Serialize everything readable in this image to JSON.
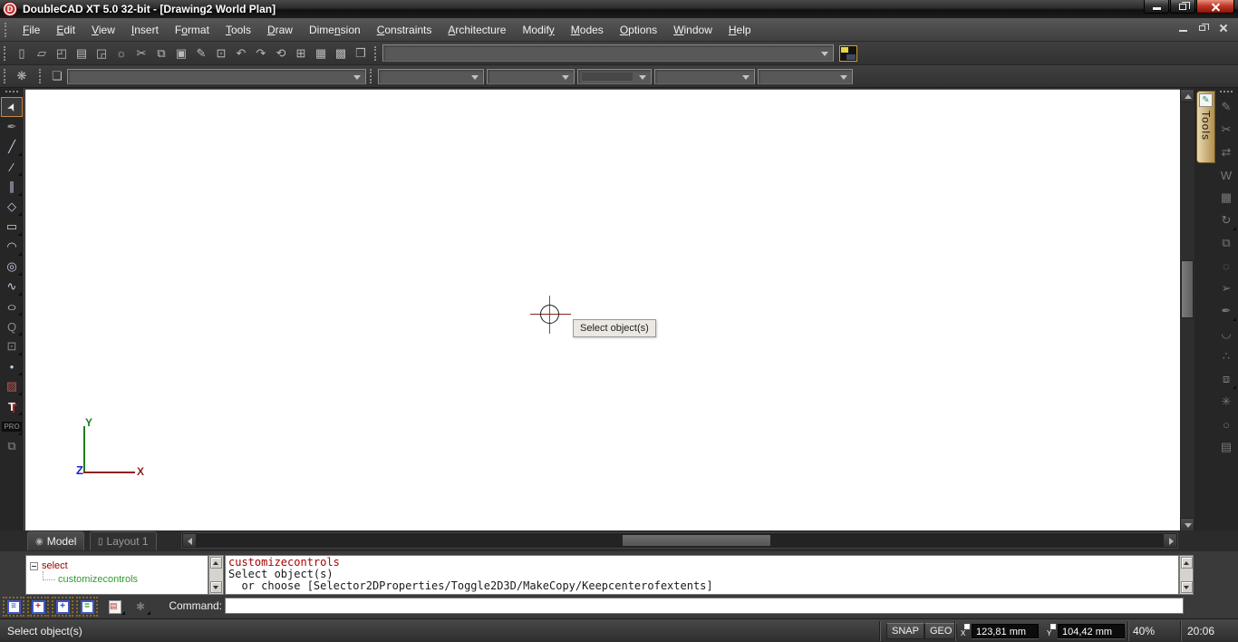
{
  "window": {
    "logo_letter": "D",
    "title": "DoubleCAD XT 5.0 32-bit - [Drawing2 World Plan]"
  },
  "menu": {
    "items": [
      {
        "pre": "",
        "key": "F",
        "post": "ile"
      },
      {
        "pre": "",
        "key": "E",
        "post": "dit"
      },
      {
        "pre": "",
        "key": "V",
        "post": "iew"
      },
      {
        "pre": "",
        "key": "I",
        "post": "nsert"
      },
      {
        "pre": "F",
        "key": "o",
        "post": "rmat"
      },
      {
        "pre": "",
        "key": "T",
        "post": "ools"
      },
      {
        "pre": "",
        "key": "D",
        "post": "raw"
      },
      {
        "pre": "Dime",
        "key": "n",
        "post": "sion"
      },
      {
        "pre": "",
        "key": "C",
        "post": "onstraints"
      },
      {
        "pre": "",
        "key": "A",
        "post": "rchitecture"
      },
      {
        "pre": "Modif",
        "key": "y",
        "post": ""
      },
      {
        "pre": "",
        "key": "M",
        "post": "odes"
      },
      {
        "pre": "",
        "key": "O",
        "post": "ptions"
      },
      {
        "pre": "",
        "key": "W",
        "post": "indow"
      },
      {
        "pre": "",
        "key": "H",
        "post": "elp"
      }
    ]
  },
  "icons": {
    "new": "▯",
    "open": "▱",
    "save": "◰",
    "print": "▤",
    "print_preview": "◲",
    "settings": "☼",
    "cut": "✂",
    "copy": "⧉",
    "paste": "▣",
    "format_brush": "✎",
    "zoom_box": "⊡",
    "undo": "↶",
    "redo": "↷",
    "rotate": "⟲",
    "zoom_extents": "⊞",
    "table": "▦",
    "calculator": "▩",
    "help_book": "❒",
    "selection_filter": "❋",
    "layers": "❏",
    "select": "➤",
    "pen": "✒",
    "line": "╱",
    "polyline": "∕",
    "double_line": "∥",
    "polygon": "◇",
    "rectangle": "▭",
    "arc": "◠",
    "circle": "◎",
    "spline": "∿",
    "ellipse": "○",
    "text_annotation": "Q",
    "group": "⊡",
    "point": "•",
    "image": "▨",
    "text": "T",
    "pro": "PRO",
    "paste_special": "⧉",
    "rt_sketch": "✎",
    "rt_trim": "✂",
    "rt_mirror": "⇄",
    "rt_wall": "W",
    "rt_hatch": "▦",
    "rt_rotate": "↻",
    "rt_array": "⧉",
    "rt_region": "◌",
    "rt_pull": "➢",
    "rt_pen": "✒",
    "rt_arc": "◡",
    "rt_node": "∴",
    "rt_blocks": "⧈",
    "rt_explode": "✳",
    "rt_circle": "○",
    "rt_plot": "▤",
    "model_tab": "◉",
    "layout_tab": "▯",
    "tools_tab_pen": "✎",
    "console_lines": "≡",
    "console_error": "+",
    "console_info": "+",
    "console_ok": "=",
    "console_doc": "▤",
    "console_pin": "✱"
  },
  "canvas": {
    "tooltip": "Select object(s)",
    "ucs": {
      "x": "X",
      "y": "Y",
      "z": "Z"
    }
  },
  "sheet_tabs": {
    "model": "Model",
    "layout": "Layout 1"
  },
  "tools_palette": {
    "label": "Tools"
  },
  "console": {
    "tree": {
      "root": "select",
      "child": "customizecontrols"
    },
    "history": [
      "customizecontrols",
      "Select object(s)",
      "  or choose [Selector2DProperties/Toggle2D3D/MakeCopy/Keepcenterofextents]"
    ],
    "command_label": "Command:",
    "command_value": ""
  },
  "status": {
    "message": "Select object(s)",
    "snap": "SNAP",
    "geo": "GEO",
    "x_label": "X",
    "x_value": "123,81 mm",
    "y_label": "Y",
    "y_value": "104,42 mm",
    "zoom": "40%",
    "time": "20:06"
  },
  "colors": {
    "close_button": "#c0392b",
    "selected_tool_border": "#c8883c",
    "ucs_x": "#8b2222",
    "ucs_y": "#1f7d1f",
    "ucs_z": "#2222cc",
    "tree_root": "#a00000",
    "tree_child": "#2f9b2f",
    "history_command": "#aa0000",
    "tools_tab": "#d7bc85",
    "canvas": "#ffffff"
  }
}
